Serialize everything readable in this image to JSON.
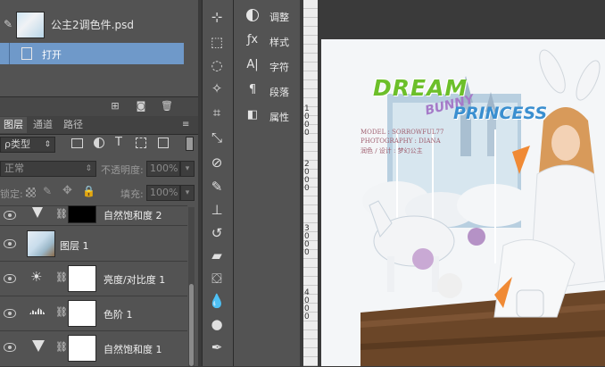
{
  "history": {
    "file_name": "公主2调色件.psd",
    "step_label": "打开"
  },
  "layers_panel": {
    "tabs": [
      "图层",
      "通道",
      "路径"
    ],
    "filter_kind": "ρ类型",
    "blend_mode": "正常",
    "opacity_label": "不透明度:",
    "opacity_value": "100%",
    "lock_label": "锁定:",
    "fill_label": "填充:",
    "fill_value": "100%",
    "layers": [
      {
        "name": "自然饱和度 2",
        "type": "adjustment-vibrance",
        "mask": "black"
      },
      {
        "name": "图层 1",
        "type": "pixel"
      },
      {
        "name": "亮度/对比度 1",
        "type": "adjustment-brightness",
        "mask": "white"
      },
      {
        "name": "色阶 1",
        "type": "adjustment-levels",
        "mask": "white"
      },
      {
        "name": "自然饱和度 1",
        "type": "adjustment-vibrance",
        "mask": "white"
      }
    ]
  },
  "adjust_panel": {
    "items": [
      {
        "label": "调整",
        "icon": "adjustments-icon"
      },
      {
        "label": "样式",
        "icon": "styles-icon"
      },
      {
        "label": "字符",
        "icon": "character-icon"
      },
      {
        "label": "段落",
        "icon": "paragraph-icon"
      },
      {
        "label": "属性",
        "icon": "properties-icon"
      }
    ]
  },
  "ruler": {
    "marks": [
      "1000",
      "2000",
      "3000",
      "4000"
    ]
  },
  "artwork": {
    "word_dream": "DREAM",
    "word_bunny": "BUNNY",
    "word_princess": "PRINCESS",
    "credits_line1": "MODEL : SORROWFUL77",
    "credits_line2": "PHOTOGRAPHY : DIANA",
    "credits_line3": "润色 / 设计 : 梦幻公主"
  },
  "colors": {
    "panel_bg": "#535353",
    "selection": "#6f99c9",
    "dream_green": "#6cbf2a",
    "bunny_purple": "#a57ac8",
    "princess_blue": "#3a8fd0"
  }
}
